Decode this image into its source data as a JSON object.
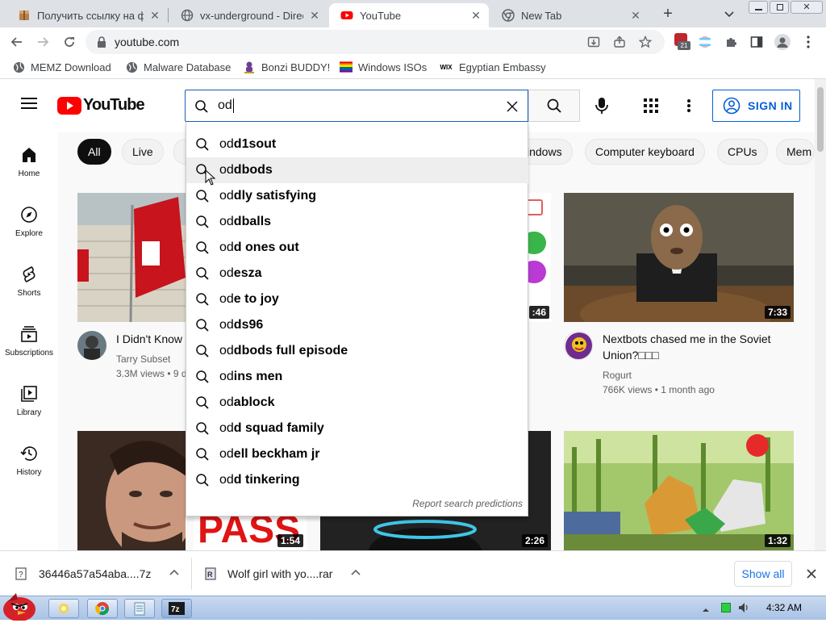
{
  "tabs": [
    {
      "title": "Получить ссылку на ф",
      "close": "✕"
    },
    {
      "title": "vx-underground - Direc",
      "close": "✕"
    },
    {
      "title": "YouTube",
      "close": "✕"
    },
    {
      "title": "New Tab",
      "close": "✕"
    }
  ],
  "new_tab": "+",
  "address": {
    "url": "youtube.com"
  },
  "extension_badge": "21",
  "bookmarks": [
    {
      "label": "MEMZ Download"
    },
    {
      "label": "Malware Database"
    },
    {
      "label": "Bonzi BUDDY!"
    },
    {
      "label": "Windows ISOs"
    },
    {
      "label": "Egyptian Embassy",
      "icon_text": "WIX"
    }
  ],
  "youtube": {
    "logo_text": "YouTube",
    "search_value": "od",
    "sign_in": "SIGN IN",
    "guide": [
      {
        "label": "Home"
      },
      {
        "label": "Explore"
      },
      {
        "label": "Shorts"
      },
      {
        "label": "Subscriptions"
      },
      {
        "label": "Library"
      },
      {
        "label": "History"
      }
    ],
    "chips": [
      {
        "label": "All"
      },
      {
        "label": "Live"
      },
      {
        "label": "indows"
      },
      {
        "label": "Computer keyboard"
      },
      {
        "label": "CPUs"
      },
      {
        "label": "Mem"
      }
    ],
    "suggestions": [
      {
        "prefix": "od",
        "rest": "d1sout"
      },
      {
        "prefix": "od",
        "rest": "dbods"
      },
      {
        "prefix": "od",
        "rest": "dly satisfying"
      },
      {
        "prefix": "od",
        "rest": "dballs"
      },
      {
        "prefix": "od",
        "rest": "d ones out"
      },
      {
        "prefix": "od",
        "rest": "esza"
      },
      {
        "prefix": "od",
        "rest": "e to joy"
      },
      {
        "prefix": "od",
        "rest": "ds96"
      },
      {
        "prefix": "od",
        "rest": "dbods full episode"
      },
      {
        "prefix": "od",
        "rest": "ins men"
      },
      {
        "prefix": "od",
        "rest": "ablock"
      },
      {
        "prefix": "od",
        "rest": "d squad family"
      },
      {
        "prefix": "od",
        "rest": "ell beckham jr"
      },
      {
        "prefix": "od",
        "rest": "d tinkering"
      }
    ],
    "report_predictions": "Report search predictions",
    "videos": [
      {
        "title": "I Didn't Know",
        "channel": "Tarry Subset",
        "meta": "3.3M views • 9 d"
      },
      {
        "duration": ":46"
      },
      {
        "title": "Nextbots chased me in the Soviet Union?□□□",
        "channel": "Rogurt",
        "meta": "766K views • 1 month ago",
        "duration": "7:33"
      },
      {
        "duration": "1:54"
      },
      {
        "duration": "2:26"
      },
      {
        "duration": "1:32"
      }
    ]
  },
  "downloads": [
    {
      "name": "36446a57a54aba....7z"
    },
    {
      "name": "Wolf girl with yo....rar"
    }
  ],
  "show_all": "Show all",
  "clock": "4:32 AM",
  "colors": {
    "youtube_red": "#ff0000",
    "accent_blue": "#065fd4",
    "search_focus": "#1c62b9"
  }
}
